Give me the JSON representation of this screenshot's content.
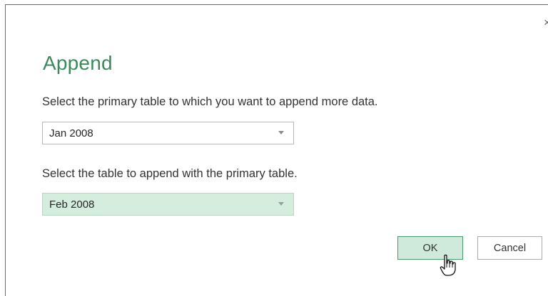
{
  "dialog": {
    "close_icon": "close-icon",
    "title": "Append",
    "primary_label": "Select the primary table to which you want to append more data.",
    "primary_value": "Jan 2008",
    "append_label": "Select the table to append with the primary table.",
    "append_value": "Feb 2008",
    "ok_label": "OK",
    "cancel_label": "Cancel"
  },
  "colors": {
    "title": "#3a8a5c",
    "selected_dropdown": "#d4eddd",
    "ok_background": "#cfeadb",
    "ok_border": "#4b9a6a"
  },
  "icons": {
    "close": "×",
    "dropdown": "chevron-down-icon",
    "cursor": "hand-pointer-icon"
  }
}
